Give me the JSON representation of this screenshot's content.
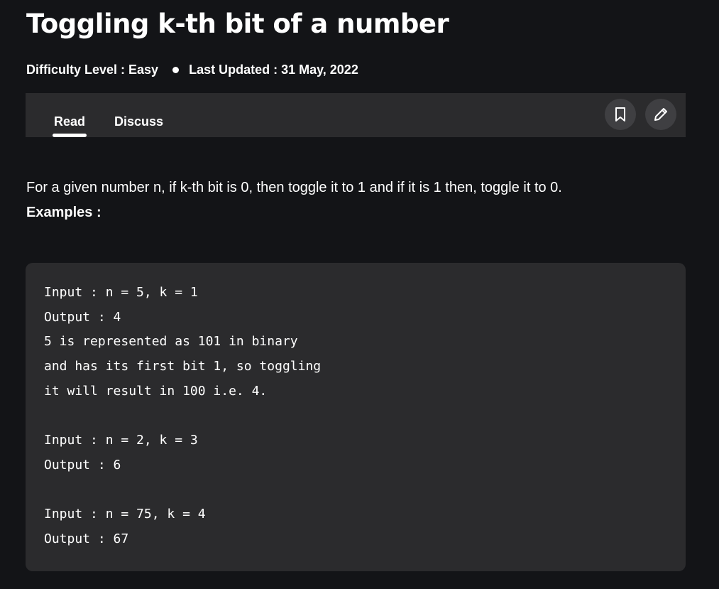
{
  "article": {
    "title": "Toggling k-th bit of a number",
    "difficulty": "Difficulty Level : Easy",
    "last_updated": "Last Updated : 31 May, 2022"
  },
  "tabs": {
    "read": "Read",
    "discuss": "Discuss",
    "active": "Read"
  },
  "icons": {
    "bookmark": "bookmark-icon",
    "edit": "pencil-icon"
  },
  "content": {
    "description": "For a given number n, if k-th bit is 0, then toggle it to 1 and if it is 1 then, toggle it to 0.",
    "examples_label": "Examples :",
    "code_lines": [
      "Input : n = 5, k = 1",
      "Output : 4",
      "5 is represented as 101 in binary",
      "and has its first bit 1, so toggling",
      "it will result in 100 i.e. 4.",
      "",
      "Input : n = 2, k = 3",
      "Output : 6",
      "",
      "Input : n = 75, k = 4",
      "Output : 67"
    ]
  },
  "colors": {
    "background": "#131417",
    "panel": "#2b2b2d",
    "icon_button": "#3f3f42",
    "text": "#ffffff"
  }
}
